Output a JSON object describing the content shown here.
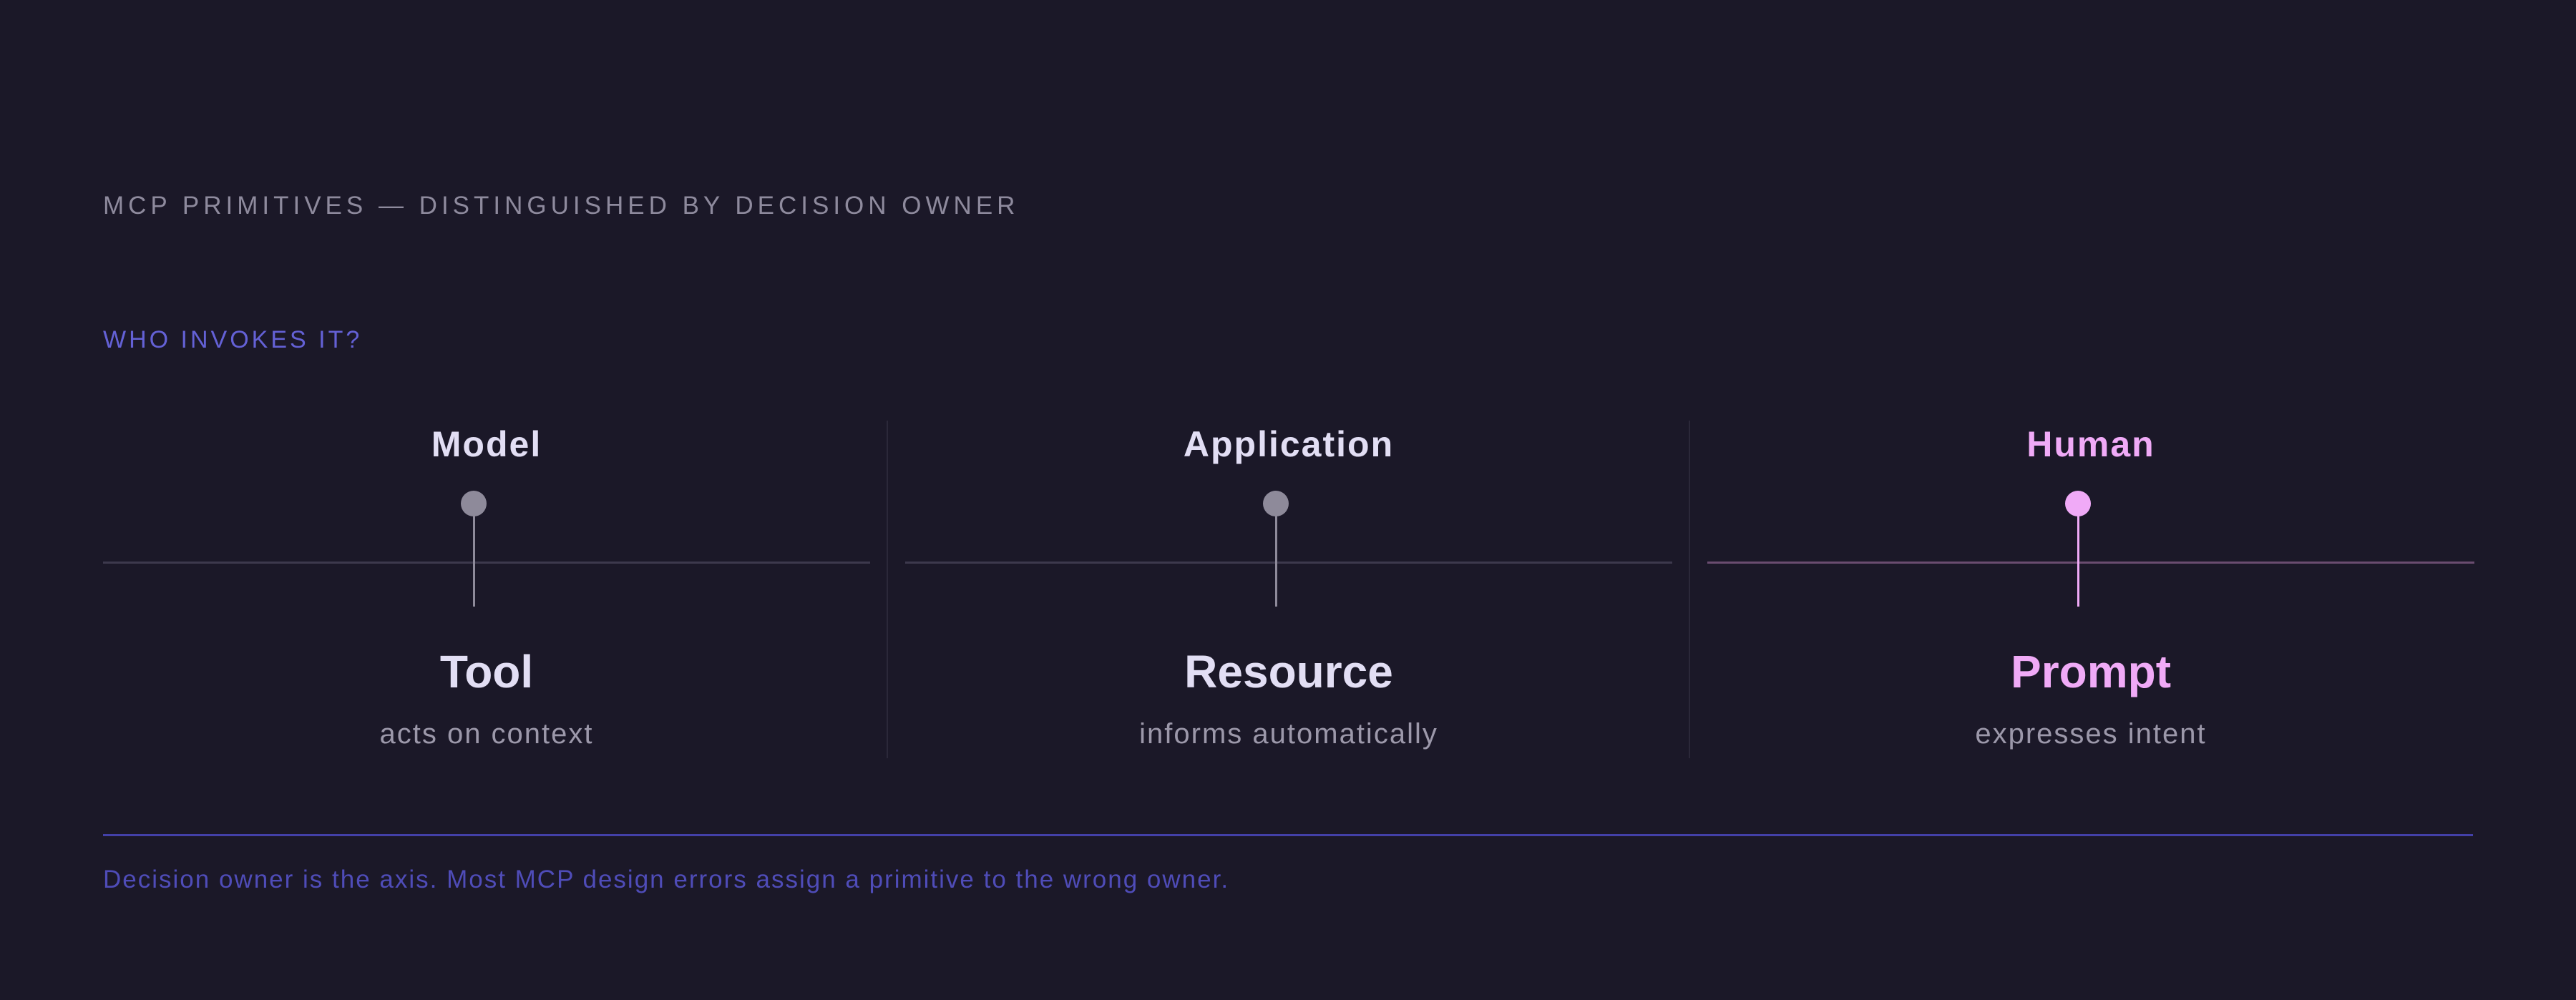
{
  "header": {
    "title": "MCP PRIMITIVES — DISTINGUISHED BY DECISION OWNER",
    "question": "WHO INVOKES IT?"
  },
  "columns": [
    {
      "owner": "Model",
      "primitive": "Tool",
      "description": "acts on context",
      "highlighted": false
    },
    {
      "owner": "Application",
      "primitive": "Resource",
      "description": "informs automatically",
      "highlighted": false
    },
    {
      "owner": "Human",
      "primitive": "Prompt",
      "description": "expresses intent",
      "highlighted": true
    }
  ],
  "footer": {
    "note": "Decision owner is the axis. Most MCP design errors assign a primitive to the wrong owner."
  },
  "colors": {
    "background": "#1b1828",
    "accent": "#6461d6",
    "highlight": "#f0aaf7",
    "neutral_marker": "#8e8a9a"
  }
}
